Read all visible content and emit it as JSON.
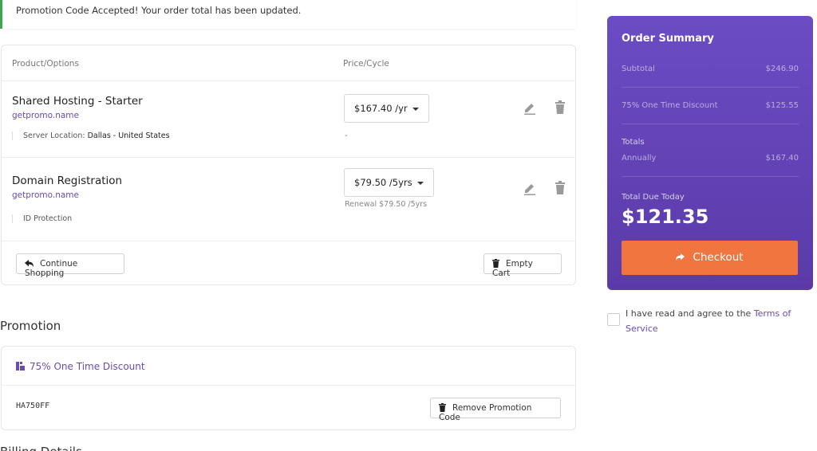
{
  "alert": {
    "text": "Promotion Code Accepted! Your order total has been updated."
  },
  "cart": {
    "headers": {
      "product": "Product/Options",
      "price": "Price/Cycle"
    },
    "items": [
      {
        "name": "Shared Hosting - Starter",
        "domain": "getpromo.name",
        "option_label": "Server Location:",
        "option_value": "Dallas - United States",
        "price": "$167.40 /yr",
        "option_price": "-"
      },
      {
        "name": "Domain Registration",
        "domain": "getpromo.name",
        "option_label": "ID Protection",
        "price": "$79.50 /5yrs",
        "renewal": "Renewal $79.50 /5yrs"
      }
    ],
    "continue_label": "Continue Shopping",
    "empty_label": "Empty Cart"
  },
  "promotion": {
    "title": "Promotion",
    "discount_label": "75% One Time Discount",
    "code": "HA750FF",
    "remove_label": "Remove Promotion Code"
  },
  "billing": {
    "title": "Billing Details"
  },
  "summary": {
    "title": "Order Summary",
    "subtotal_label": "Subtotal",
    "subtotal_value": "$246.90",
    "discount_label": "75% One Time Discount",
    "discount_value": "$125.55",
    "totals_label": "Totals",
    "annually_label": "Annually",
    "annually_value": "$167.40",
    "due_label": "Total Due Today",
    "due_value": "$121.35",
    "checkout_label": "Checkout"
  },
  "tos": {
    "prefix": "I have read and agree to the ",
    "link": "Terms of Service"
  },
  "colors": {
    "accent": "#6b4cc4",
    "checkout": "#f0753f",
    "success": "#3fa64a"
  },
  "icons": [
    "edit-icon",
    "trash-icon",
    "reply-arrow-icon",
    "tag-icon",
    "arrow-right-icon"
  ]
}
